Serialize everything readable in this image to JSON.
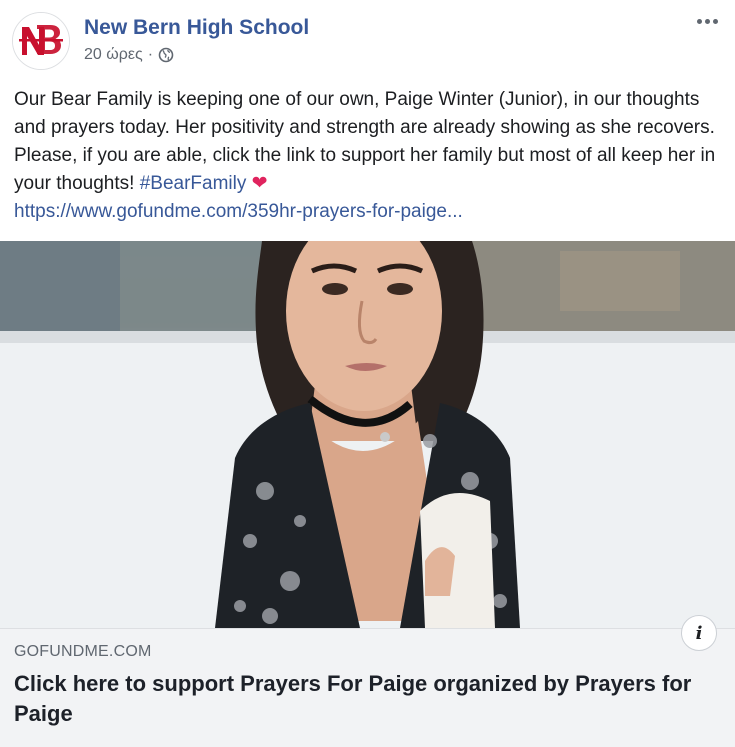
{
  "post": {
    "page_name": "New Bern High School",
    "time": "20 ώρες",
    "separator": "·",
    "privacy_icon": "globe-icon",
    "avatar_icon": "nb-monogram-logo",
    "more_icon": "more-options-icon",
    "text": {
      "body": "Our Bear Family is keeping one of our own, Paige Winter (Junior), in our thoughts and prayers today. Her positivity and strength are already showing as she recovers. Please, if you are able, click the link to support her family but most of all keep her in your thoughts! ",
      "hashtag": "#BearFamily",
      "emoji": "❤",
      "link": "https://www.gofundme.com/359hr-prayers-for-paige..."
    }
  },
  "link_preview": {
    "domain": "GOFUNDME.COM",
    "headline": "Click here to support Prayers For Paige organized by Prayers for Paige",
    "info_icon": "info-icon",
    "info_glyph": "i"
  },
  "colors": {
    "link": "#385898",
    "logo_red": "#c8102e",
    "footer_bg": "#f2f3f5"
  }
}
